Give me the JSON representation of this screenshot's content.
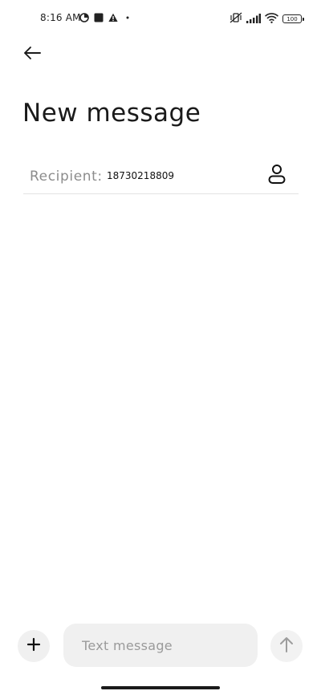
{
  "status_bar": {
    "time": "8:16 AM",
    "battery": "100",
    "icons": [
      "data-saver-icon",
      "square-notification-icon",
      "warning-icon",
      "dot-icon",
      "vibrate-off-icon",
      "signal-icon",
      "wifi-icon",
      "battery-icon"
    ]
  },
  "header": {
    "back_icon": "arrow-left-icon",
    "title": "New message"
  },
  "recipient": {
    "label": "Recipient:",
    "value": "18730218809",
    "contact_icon": "person-icon"
  },
  "composer": {
    "attach_icon": "plus-icon",
    "placeholder": "Text message",
    "value": "",
    "send_icon": "arrow-up-icon"
  },
  "colors": {
    "background": "#ffffff",
    "field_background": "#f0f0f0",
    "placeholder": "#9a9a9a",
    "label": "#8c8c8c",
    "divider": "#e3e3e3"
  }
}
